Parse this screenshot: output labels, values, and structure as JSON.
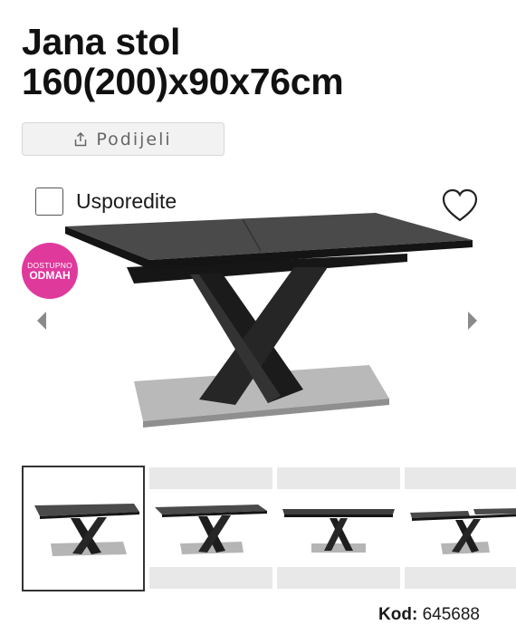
{
  "product": {
    "title_line1": "Jana stol",
    "title_line2": "160(200)x90x76cm",
    "share_label": "Podijeli",
    "compare_label": "Usporedite",
    "badge_line1": "DOSTUPNO",
    "badge_line2": "ODMAH",
    "code_label": "Kod:",
    "code_value": "645688"
  },
  "icons": {
    "share": "share-icon",
    "heart": "heart-icon",
    "prev": "chevron-left-icon",
    "next": "chevron-right-icon"
  },
  "colors": {
    "badge": "#e0399c",
    "table_top": "#4a4a4a",
    "base_steel": "#b9b9b9"
  },
  "gallery": {
    "thumbnail_count": 4,
    "active_index": 0
  }
}
